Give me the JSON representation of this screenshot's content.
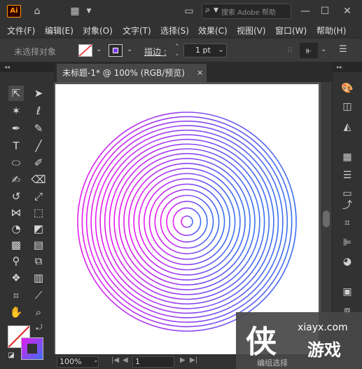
{
  "app": {
    "logo": "Ai",
    "search_placeholder": "搜索 Adobe 帮助"
  },
  "menu": [
    "文件(F)",
    "编辑(E)",
    "对象(O)",
    "文字(T)",
    "选择(S)",
    "效果(C)",
    "视图(V)",
    "窗口(W)",
    "帮助(H)"
  ],
  "control_bar": {
    "selection_status": "未选择对象",
    "stroke_label": "描边 :",
    "stroke_value": "1 pt"
  },
  "document": {
    "tab_title": "未标题-1* @ 100% (RGB/预览)",
    "close_glyph": "×"
  },
  "status": {
    "zoom": "100%",
    "artboard_number": "1"
  },
  "artwork": {
    "circle_count": 21,
    "gradient_from": "#e31cf0",
    "gradient_to": "#3b6ff0",
    "stroke_color": "#8a3ee6"
  },
  "watermark": {
    "glyph": "侠",
    "url": "xiayx.com",
    "brand": "游戏",
    "status_text": "编组选择"
  },
  "colors": {
    "panel": "#323232",
    "control_bar": "#3a3a3a",
    "workspace": "#535353",
    "accent_logo": "#ff9a00"
  }
}
